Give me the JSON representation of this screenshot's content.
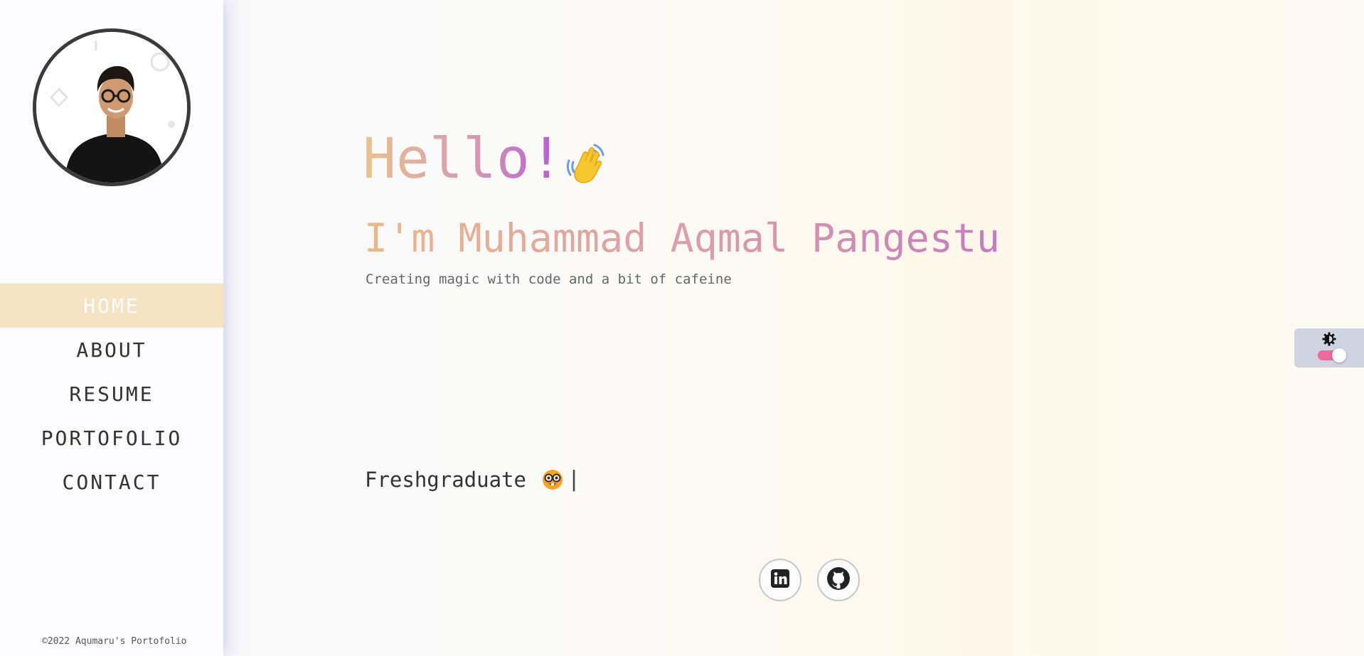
{
  "sidebar": {
    "avatar_alt": "profile photo",
    "nav": [
      {
        "label": "HOME",
        "active": true
      },
      {
        "label": "ABOUT",
        "active": false
      },
      {
        "label": "RESUME",
        "active": false
      },
      {
        "label": "PORTOFOLIO",
        "active": false
      },
      {
        "label": "CONTACT",
        "active": false
      }
    ],
    "copyright": "©2022 Aqumaru's Portofolio"
  },
  "hero": {
    "greeting": "Hello!",
    "greeting_icon": "waving-hand-icon",
    "name": "I'm Muhammad Aqmal Pangestu",
    "tagline": "Creating magic with code and a bit of cafeine",
    "typed_text": "Freshgraduate",
    "typed_icon": "nerd-face-icon",
    "cursor": "|"
  },
  "socials": [
    {
      "icon": "linkedin-icon"
    },
    {
      "icon": "github-icon"
    }
  ],
  "theme_toggle": {
    "icon": "brightness-icon",
    "on": true
  },
  "colors": {
    "active_nav_bg": "#f6e3c4",
    "toggle_panel_bg": "#d0d3e0",
    "switch_on": "#ec6a9e",
    "sidebar_shadow": "#a5a8d7"
  }
}
